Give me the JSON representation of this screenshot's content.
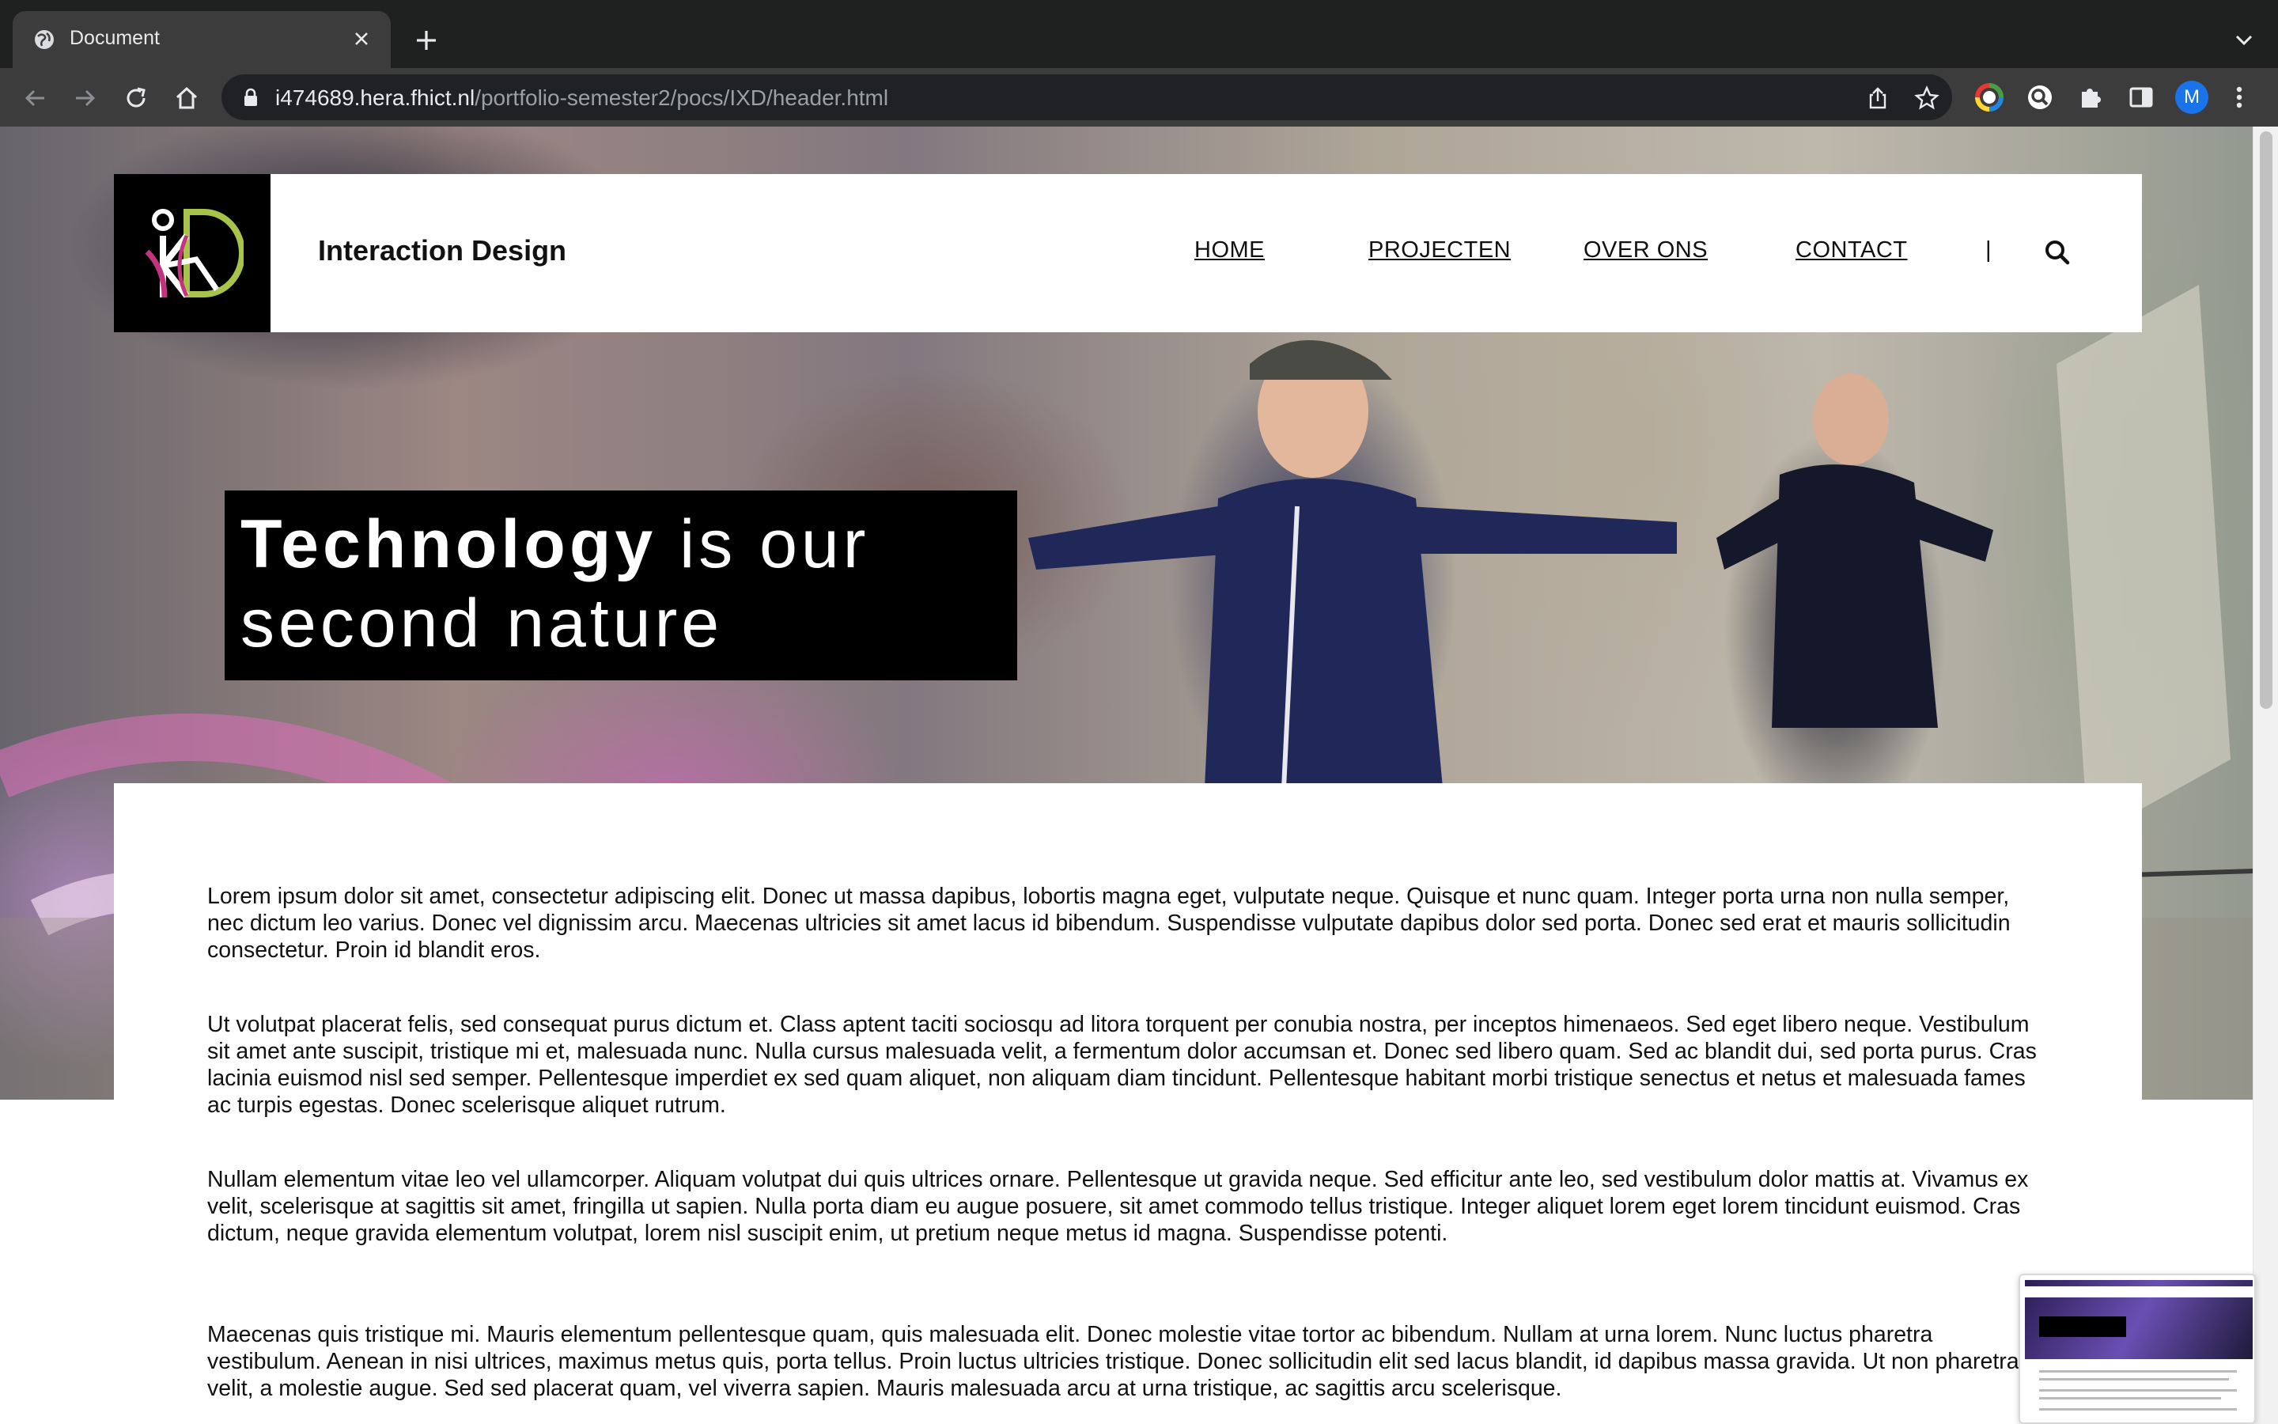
{
  "browser": {
    "tab_title": "Document",
    "url_host": "i474689.hera.fhict.nl",
    "url_path": "/portfolio-semester2/pocs/IXD/header.html",
    "avatar_letter": "M",
    "avatar_color": "#1a73e8"
  },
  "site": {
    "title": "Interaction Design",
    "nav": {
      "home": "HOME",
      "projects": "PROJECTEN",
      "about": "OVER ONS",
      "contact": "CONTACT",
      "separator": "|"
    },
    "tagline_bold": "Technology",
    "tagline_rest": " is our second nature",
    "paragraphs": [
      "Lorem ipsum dolor sit amet, consectetur adipiscing elit. Donec ut massa dapibus, lobortis magna eget, vulputate neque. Quisque et nunc quam. Integer porta urna non nulla semper, nec dictum leo varius. Donec vel dignissim arcu. Maecenas ultricies sit amet lacus id bibendum. Suspendisse vulputate dapibus dolor sed porta. Donec sed erat et mauris sollicitudin consectetur. Proin id blandit eros.",
      "Ut volutpat placerat felis, sed consequat purus dictum et. Class aptent taciti sociosqu ad litora torquent per conubia nostra, per inceptos himenaeos. Sed eget libero neque. Vestibulum sit amet ante suscipit, tristique mi et, malesuada nunc. Nulla cursus malesuada velit, a fermentum dolor accumsan et. Donec sed libero quam. Sed ac blandit dui, sed porta purus. Cras lacinia euismod nisl sed semper. Pellentesque imperdiet ex sed quam aliquet, non aliquam diam tincidunt. Pellentesque habitant morbi tristique senectus et netus et malesuada fames ac turpis egestas. Donec scelerisque aliquet rutrum.",
      "Nullam elementum vitae leo vel ullamcorper. Aliquam volutpat dui quis ultrices ornare. Pellentesque ut gravida neque. Sed efficitur ante leo, sed vestibulum dolor mattis at. Vivamus ex velit, scelerisque at sagittis sit amet, fringilla ut sapien. Nulla porta diam eu augue posuere, sit amet commodo tellus tristique. Integer aliquet lorem eget lorem tincidunt euismod. Cras dictum, neque gravida elementum volutpat, lorem nisl suscipit enim, ut pretium neque metus id magna. Suspendisse potenti.",
      "Maecenas quis tristique mi. Mauris elementum pellentesque quam, quis malesuada elit. Donec molestie vitae tortor ac bibendum. Nullam at urna lorem. Nunc luctus pharetra vestibulum. Aenean in nisi ultrices, maximus metus quis, porta tellus. Proin luctus ultricies tristique. Donec sollicitudin elit sed lacus blandit, id dapibus massa gravida. Ut non pharetra velit, a molestie augue. Sed sed placerat quam, vel viverra sapien. Mauris malesuada arcu at urna tristique, ac sagittis arcu scelerisque."
    ]
  },
  "icons": {
    "browser_toolbar": [
      "back-icon",
      "forward-icon",
      "reload-icon",
      "home-icon",
      "lock-icon",
      "share-icon",
      "star-icon"
    ],
    "extensions": [
      "color-picker-extension-icon",
      "search-lens-extension-icon",
      "puzzle-extensions-icon",
      "side-panel-icon",
      "kebab-menu-icon"
    ],
    "site": [
      "id-logo-icon",
      "search-icon"
    ]
  },
  "colors": {
    "logo_green": "#a8c34a",
    "logo_pink": "#c2357e",
    "header_bg": "#ffffff",
    "tagline_bg": "#000000"
  }
}
